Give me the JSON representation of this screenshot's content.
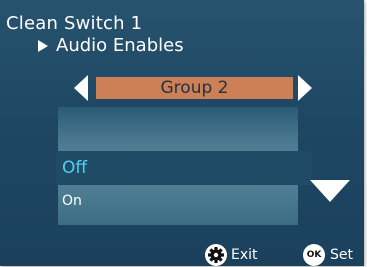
{
  "header": {
    "title": "Clean Switch 1",
    "subtitle": "Audio Enables"
  },
  "selector": {
    "value": "Group 2"
  },
  "options": {
    "selected": "Off",
    "next": "On"
  },
  "footer": {
    "exit_label": "Exit",
    "set_label": "Set",
    "ok_badge": "OK"
  },
  "colors": {
    "background": "#1f4864",
    "selector_fill": "#cd7f55",
    "highlight_text": "#4fd2f0"
  },
  "icons": {
    "marker": "triangle-right-icon",
    "prev": "arrow-left-icon",
    "next": "arrow-right-icon",
    "scroll": "arrow-down-icon",
    "exit": "gear-icon",
    "set": "ok-icon"
  }
}
